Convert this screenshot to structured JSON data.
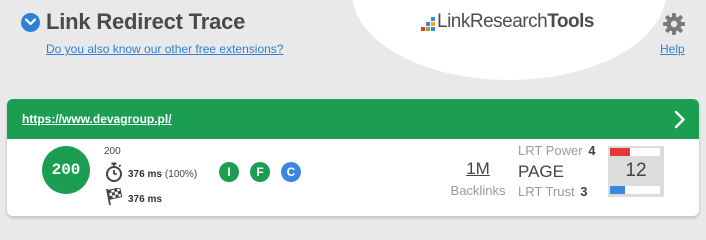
{
  "header": {
    "title": "Link Redirect Trace",
    "extensions_link": "Do you also know our other free extensions?",
    "brand_light": "Link",
    "brand_mid": "Research",
    "brand_bold": "Tools",
    "help_label": "Help"
  },
  "brand_dot_colors": [
    "#f5a623",
    "#e53935",
    "#3b86e0",
    "#7cb342",
    "#3b86e0",
    "#f5a623",
    "#e53935",
    "#7cb342",
    "#3b86e0"
  ],
  "result": {
    "url": "https://www.devagroup.pl/",
    "status_code": "200",
    "status_small": "200",
    "time_ms": "376 ms",
    "time_pct": "(100%)",
    "final_ms": "376 ms",
    "badges": [
      {
        "letter": "I",
        "color": "#1b9e52"
      },
      {
        "letter": "F",
        "color": "#1b9e52"
      },
      {
        "letter": "C",
        "color": "#3b86e0"
      }
    ],
    "backlinks_value": "1M",
    "backlinks_label": "Backlinks",
    "lrt_power_label": "LRT Power",
    "lrt_power_value": "4",
    "page_label": "PAGE",
    "lrt_trust_label": "LRT Trust",
    "lrt_trust_value": "3",
    "score": "12",
    "power_level": 0.4,
    "trust_level": 0.3
  },
  "colors": {
    "accent_green": "#1b9e52",
    "link_blue": "#2f7fd6",
    "power_red": "#e53935",
    "trust_blue": "#3b86e0"
  }
}
